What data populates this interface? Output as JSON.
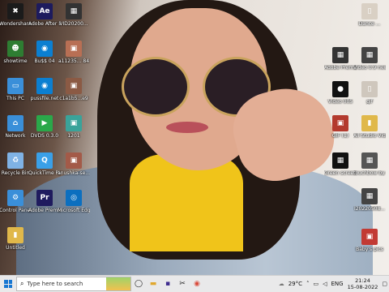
{
  "desktop": {
    "icons_left": [
      {
        "id": "wondershare",
        "label": "Wondershare Filmora9",
        "color": "#1b1b1b",
        "glyph": "✖"
      },
      {
        "id": "aftereffects",
        "label": "Adobe After Effects 2020",
        "color": "#1d1b5e",
        "glyph": "Ae"
      },
      {
        "id": "video1",
        "label": "VID20200...",
        "color": "#333333",
        "glyph": "▦"
      },
      {
        "id": "showtime",
        "label": "showtime",
        "color": "#2e7d32",
        "glyph": "☻"
      },
      {
        "id": "buss",
        "label": "Bu$$ 04",
        "color": "#0b7fd1",
        "glyph": "◉"
      },
      {
        "id": "img1",
        "label": "a11235... 84",
        "color": "#b86f54",
        "glyph": "▣"
      },
      {
        "id": "thispc",
        "label": "This PC",
        "color": "#3a8fd9",
        "glyph": "▭"
      },
      {
        "id": "pussfile",
        "label": "pussfile.net",
        "color": "#0b7fd1",
        "glyph": "◉"
      },
      {
        "id": "img2",
        "label": "c1a1b5...e9",
        "color": "#8b5a44",
        "glyph": "▣"
      },
      {
        "id": "network",
        "label": "Network",
        "color": "#3a8fd9",
        "glyph": "⌂"
      },
      {
        "id": "dvd",
        "label": "DVDS 0.3.0",
        "color": "#2aa84a",
        "glyph": "▶"
      },
      {
        "id": "img3",
        "label": "1201",
        "color": "#3aa39a",
        "glyph": "▣"
      },
      {
        "id": "recycle",
        "label": "Recycle Bin",
        "color": "#7fb2e5",
        "glyph": "♻"
      },
      {
        "id": "quicktime",
        "label": "QuickTime Player",
        "color": "#3aa0e8",
        "glyph": "Q"
      },
      {
        "id": "anushka",
        "label": "anushka-se...",
        "color": "#a35a48",
        "glyph": "▣"
      },
      {
        "id": "control",
        "label": "Control Panel",
        "color": "#3a8fd9",
        "glyph": "⚙"
      },
      {
        "id": "premiere",
        "label": "Adobe Premiere P...",
        "color": "#1f1b5e",
        "glyph": "Pr"
      },
      {
        "id": "edge",
        "label": "Microsoft Edge",
        "color": "#0c6fbf",
        "glyph": "◎"
      },
      {
        "id": "untitled",
        "label": "Untitled",
        "color": "#e0b84a",
        "glyph": "▮"
      }
    ],
    "icons_right": [
      {
        "id": "r1",
        "label": "Dance ...",
        "color": "#d9d0c4",
        "glyph": "▯"
      },
      {
        "id": "r2",
        "label": "Adobe Premiere Pro...",
        "color": "#333333",
        "glyph": "▦"
      },
      {
        "id": "r3",
        "label": "Video 0.9 new",
        "color": "#444444",
        "glyph": "▦"
      },
      {
        "id": "r4",
        "label": "Video 005",
        "color": "#111111",
        "glyph": "●"
      },
      {
        "id": "r5",
        "label": "gif",
        "color": "#cfc7bd",
        "glyph": "▯"
      },
      {
        "id": "r6",
        "label": "GIF (1)",
        "color": "#b33a2e",
        "glyph": "▣"
      },
      {
        "id": "r7",
        "label": "All Studio Videos",
        "color": "#e0b84a",
        "glyph": "▮"
      },
      {
        "id": "r8",
        "label": "Green screen Plane...",
        "color": "#111111",
        "glyph": "▦"
      },
      {
        "id": "r9",
        "label": "touchbow by dream tour",
        "color": "#555555",
        "glyph": "▦"
      },
      {
        "id": "r10",
        "label": "I20220508...",
        "color": "#444444",
        "glyph": "▦"
      },
      {
        "id": "r11",
        "label": "Baby's pics",
        "color": "#c23a33",
        "glyph": "▣"
      }
    ]
  },
  "taskbar": {
    "search_placeholder": "Type here to search",
    "temperature": "29°C",
    "language": "ENG",
    "time": "21:24",
    "date": "15-08-2022"
  }
}
